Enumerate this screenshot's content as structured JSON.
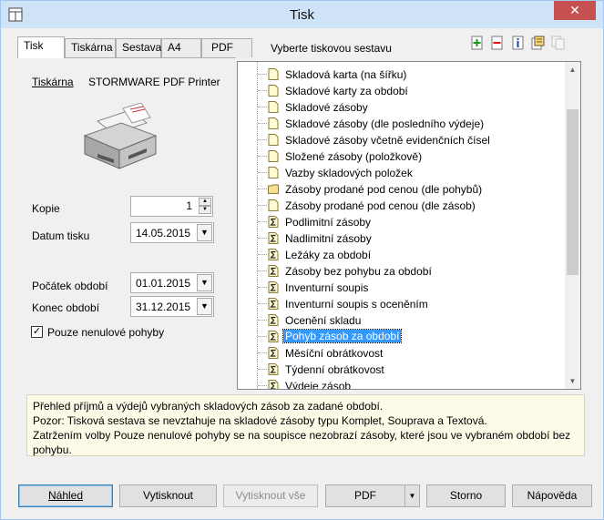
{
  "window": {
    "title": "Tisk",
    "close": "✕"
  },
  "tabs": [
    {
      "label": "Tisk",
      "active": true
    },
    {
      "label": "Tiskárna"
    },
    {
      "label": "Sestava"
    },
    {
      "label": "A4"
    },
    {
      "label": "PDF"
    }
  ],
  "panel_title": "Vyberte tiskovou sestavu",
  "printer": {
    "link": "Tiskárna",
    "name": "STORMWARE PDF Printer"
  },
  "fields": {
    "copies_label": "Kopie",
    "copies_value": "1",
    "print_date_label": "Datum tisku",
    "print_date_value": "14.05.2015",
    "period_start_label": "Počátek období",
    "period_start_value": "01.01.2015",
    "period_end_label": "Konec období",
    "period_end_value": "31.12.2015",
    "nonzero_label": "Pouze nenulové pohyby",
    "nonzero_checked": true
  },
  "reports": [
    {
      "label": "Skladová karta (na šířku)",
      "icon": "page"
    },
    {
      "label": "Skladové karty za období",
      "icon": "page"
    },
    {
      "label": "Skladové zásoby",
      "icon": "page"
    },
    {
      "label": "Skladové zásoby (dle posledního výdeje)",
      "icon": "page"
    },
    {
      "label": "Skladové zásoby včetně evidenčních čísel",
      "icon": "page"
    },
    {
      "label": "Složené zásoby (položkově)",
      "icon": "page"
    },
    {
      "label": "Vazby skladových položek",
      "icon": "page"
    },
    {
      "label": "Zásoby prodané pod cenou (dle pohybů)",
      "icon": "folder"
    },
    {
      "label": "Zásoby prodané pod cenou (dle zásob)",
      "icon": "page"
    },
    {
      "label": "Podlimitní zásoby",
      "icon": "sigma"
    },
    {
      "label": "Nadlimitní zásoby",
      "icon": "sigma"
    },
    {
      "label": "Ležáky za období",
      "icon": "sigma"
    },
    {
      "label": "Zásoby bez pohybu za období",
      "icon": "sigma"
    },
    {
      "label": "Inventurní soupis",
      "icon": "sigma"
    },
    {
      "label": "Inventurní soupis s oceněním",
      "icon": "sigma"
    },
    {
      "label": "Ocenění skladu",
      "icon": "sigma"
    },
    {
      "label": "Pohyb zásob za období",
      "icon": "sigma",
      "selected": true
    },
    {
      "label": "Měsíční obrátkovost",
      "icon": "sigma"
    },
    {
      "label": "Týdenní obrátkovost",
      "icon": "sigma"
    },
    {
      "label": "Výdeje zásob",
      "icon": "sigma"
    }
  ],
  "description": {
    "line1": "Přehled příjmů a výdejů vybraných skladových zásob za zadané období.",
    "line2": "Pozor: Tisková sestava se nevztahuje na skladové zásoby typu Komplet, Souprava a Textová.",
    "line3": "Zatržením volby Pouze nenulové pohyby se na soupisce nezobrazí zásoby, které jsou ve vybraném období bez pohybu."
  },
  "buttons": {
    "preview": "Náhled",
    "print": "Vytisknout",
    "print_all": "Vytisknout vše",
    "pdf": "PDF",
    "cancel": "Storno",
    "help": "Nápověda"
  },
  "colors": {
    "selection": "#3399ff",
    "description_bg": "#fdfbe7",
    "title_bar": "#cfe3f8",
    "close": "#c75050"
  }
}
